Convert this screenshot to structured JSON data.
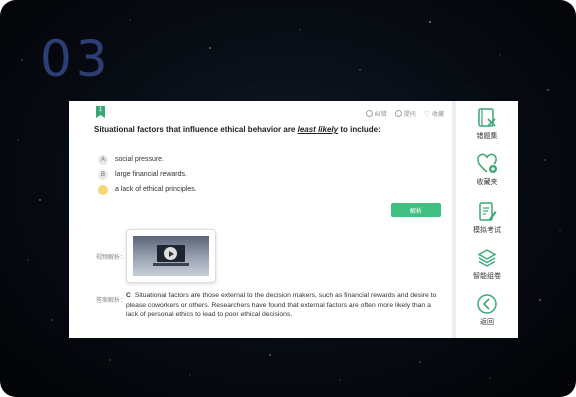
{
  "step_number": "03",
  "toolbar": {
    "correct_label": "纠错",
    "ask_label": "提问",
    "favorite_label": "收藏"
  },
  "question": {
    "index": "1",
    "text_before": "Situational factors that influence ethical behavior are ",
    "emphasis": "least likely",
    "text_after": " to include:"
  },
  "options": [
    {
      "letter": "A",
      "text": "social pressure."
    },
    {
      "letter": "B",
      "text": "large financial rewards."
    },
    {
      "letter": "C",
      "text": "a lack of ethical principles."
    }
  ],
  "analysis_button_label": "解析",
  "video": {
    "label": "视频解析："
  },
  "answer": {
    "label": "答案解析：",
    "letter": "C",
    "explanation": "Situational factors are those external to the decision makers, such as financial rewards and desire to please coworkers or others. Researchers have found that external factors are often more likely than a lack of personal ethics to lead to poor ethical decisions."
  },
  "sidebar": {
    "items": [
      {
        "label": "错题集",
        "icon": "error-book-icon"
      },
      {
        "label": "收藏夹",
        "icon": "heart-plus-icon"
      },
      {
        "label": "模拟考试",
        "icon": "exam-edit-icon"
      },
      {
        "label": "智能组卷",
        "icon": "layers-icon"
      },
      {
        "label": "返回",
        "icon": "back-icon"
      }
    ]
  },
  "colors": {
    "accent_green": "#3fbf80",
    "step_number": "#2d3e74",
    "selected_option": "#f5d77a",
    "sidebar_icon": "#3aa776"
  }
}
